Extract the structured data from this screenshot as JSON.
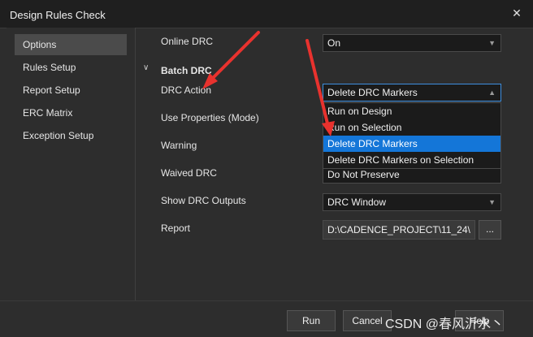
{
  "window": {
    "title": "Design Rules Check",
    "close_icon": "close-icon"
  },
  "sidebar": {
    "items": [
      {
        "label": "Options",
        "active": true
      },
      {
        "label": "Rules Setup"
      },
      {
        "label": "Report Setup"
      },
      {
        "label": "ERC Matrix"
      },
      {
        "label": "Exception Setup"
      }
    ]
  },
  "online_drc": {
    "label": "Online DRC",
    "value": "On"
  },
  "batch_drc": {
    "section_label": "Batch DRC",
    "drc_action": {
      "label": "DRC Action",
      "value": "Delete DRC Markers"
    },
    "use_properties": {
      "label": "Use Properties (Mode)"
    },
    "warning": {
      "label": "Warning"
    },
    "waived_drc": {
      "label": "Waived DRC",
      "value": "Do Not Preserve"
    },
    "show_drc_outputs": {
      "label": "Show DRC Outputs",
      "value": "DRC Window"
    },
    "report": {
      "label": "Report",
      "value": "D:\\CADENCE_PROJECT\\11_24\\",
      "browse_label": "..."
    }
  },
  "dropdown": {
    "options": [
      "Run on Design",
      "Run on Selection",
      "Delete DRC Markers",
      "Delete DRC Markers on Selection"
    ],
    "selected_index": 2
  },
  "buttons": {
    "run": "Run",
    "cancel": "Cancel",
    "help": "Help"
  },
  "watermark": "CSDN @春风沂水丶",
  "colors": {
    "accent": "#1476d8",
    "annotation_arrow": "#e8322e"
  }
}
